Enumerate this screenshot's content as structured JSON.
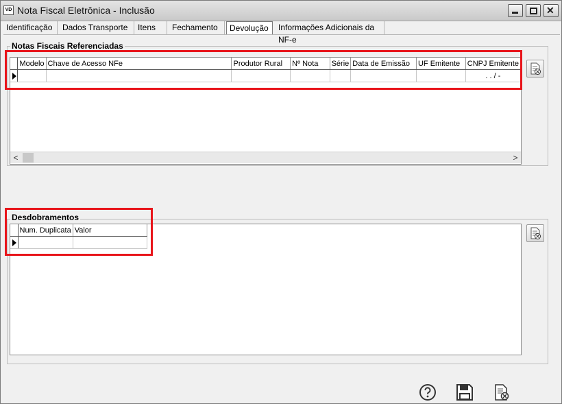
{
  "window": {
    "title": "Nota Fiscal Eletrônica - Inclusão",
    "app_icon_text": "VD"
  },
  "tabs": [
    {
      "label": "Identificação"
    },
    {
      "label": "Dados Transporte"
    },
    {
      "label": "Itens"
    },
    {
      "label": "Fechamento"
    },
    {
      "label": "Devolução",
      "active": true
    },
    {
      "label": "Informações Adicionais da NF-e"
    }
  ],
  "notas": {
    "title": "Notas Fiscais Referenciadas",
    "columns": [
      "Modelo",
      "Chave de Acesso NFe",
      "Produtor Rural",
      "Nº Nota",
      "Série",
      "Data de Emissão",
      "UF Emitente",
      "CNPJ Emitente"
    ],
    "row": [
      "",
      "",
      "",
      "",
      "",
      "",
      "",
      ". . /  -"
    ]
  },
  "desdobramentos": {
    "title": "Desdobramentos",
    "columns": [
      "Num. Duplicata",
      "Valor"
    ],
    "row": [
      "",
      ""
    ]
  },
  "scroll": {
    "left": "<",
    "right": ">"
  },
  "colors": {
    "highlight": "#e8151b"
  }
}
